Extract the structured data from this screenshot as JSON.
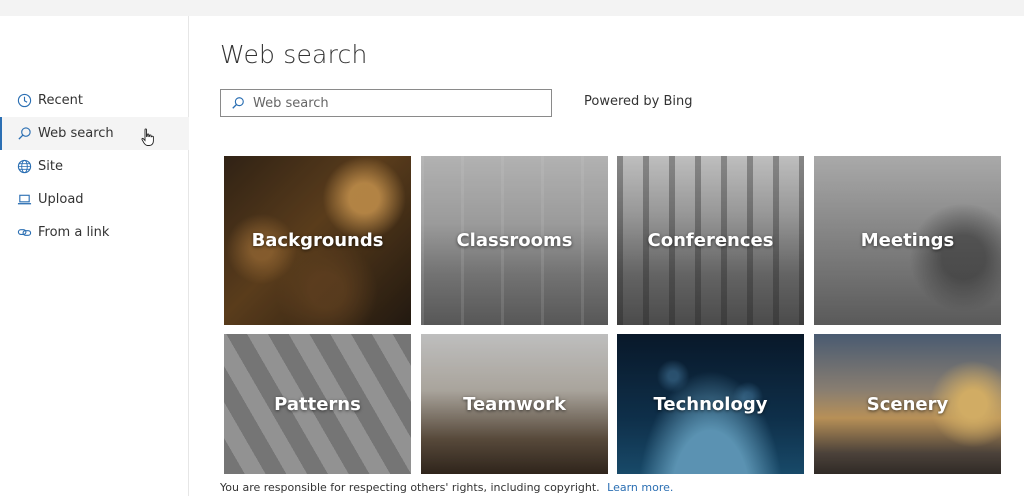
{
  "sidebar": {
    "items": [
      {
        "label": "Recent",
        "icon": "clock-icon",
        "active": false
      },
      {
        "label": "Web search",
        "icon": "search-icon",
        "active": true
      },
      {
        "label": "Site",
        "icon": "globe-icon",
        "active": false
      },
      {
        "label": "Upload",
        "icon": "laptop-upload-icon",
        "active": false
      },
      {
        "label": "From a link",
        "icon": "link-icon",
        "active": false
      }
    ]
  },
  "main": {
    "title": "Web search",
    "search": {
      "placeholder": "Web search",
      "value": ""
    },
    "powered_by": "Powered by Bing",
    "tiles": [
      {
        "label": "Backgrounds"
      },
      {
        "label": "Classrooms"
      },
      {
        "label": "Conferences"
      },
      {
        "label": "Meetings"
      },
      {
        "label": "Patterns"
      },
      {
        "label": "Teamwork"
      },
      {
        "label": "Technology"
      },
      {
        "label": "Scenery"
      }
    ]
  },
  "footer": {
    "text": "You are responsible for respecting others' rights, including copyright.",
    "link": "Learn more."
  },
  "colors": {
    "accent": "#2b6fb3",
    "active_bg": "#f4f4f4"
  }
}
